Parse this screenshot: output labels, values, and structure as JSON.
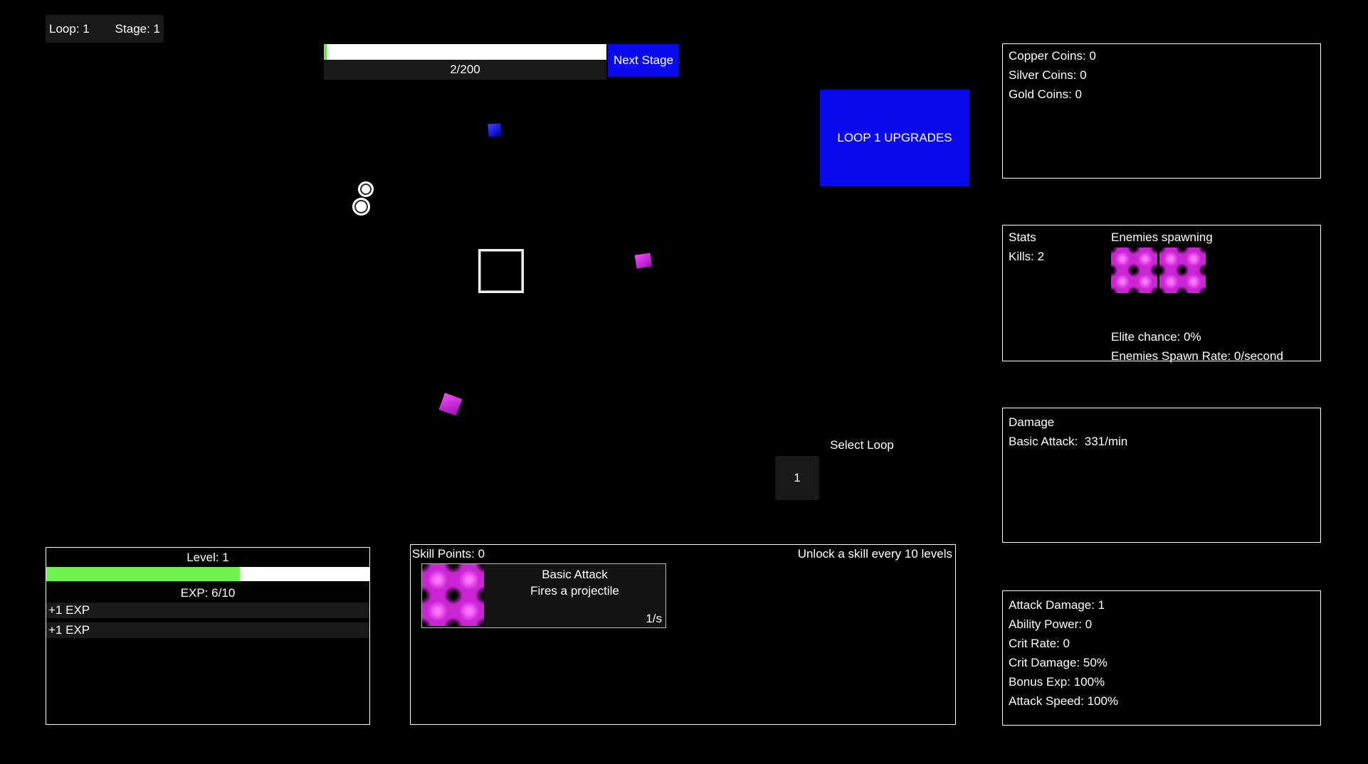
{
  "hud": {
    "loop": "Loop: 1",
    "stage": "Stage: 1"
  },
  "stage_progress": {
    "label": "2/200",
    "percent": 1,
    "next_stage": "Next Stage"
  },
  "upgrades": {
    "label": "LOOP 1 UPGRADES"
  },
  "coins": {
    "lines": [
      "Copper Coins: 0",
      "Silver Coins: 0",
      "Gold Coins: 0"
    ]
  },
  "stats": {
    "title": "Stats",
    "kills": "Kills: 2",
    "enemies_spawning": "Enemies spawning",
    "elite_chance": "Elite chance: 0%",
    "spawn_rate": "Enemies Spawn Rate: 0/second"
  },
  "damage": {
    "title": "Damage",
    "basic_attack": "Basic Attack:  331/min"
  },
  "attributes": {
    "lines": [
      "Attack Damage: 1",
      "Ability Power: 0",
      "Crit Rate: 0",
      "Crit Damage: 50%",
      "Bonus Exp: 100%",
      "Attack Speed: 100%"
    ]
  },
  "select_loop": {
    "title": "Select Loop",
    "loop_1": "1"
  },
  "level": {
    "title": "Level: 1",
    "exp": "EXP: 6/10",
    "exp_percent": 60,
    "log": [
      "+1 EXP",
      "+1 EXP"
    ]
  },
  "skills": {
    "points": "Skill Points: 0",
    "unlock_hint": "Unlock a skill every 10 levels",
    "basic_attack": {
      "name": "Basic Attack",
      "description": "Fires a projectile",
      "rate": "1/s"
    }
  },
  "colors": {
    "accent_blue": "#0909ee",
    "exp_green": "#6ef44c",
    "enemy_magenta": "#cb24d4",
    "panel_gray": "#191919"
  }
}
